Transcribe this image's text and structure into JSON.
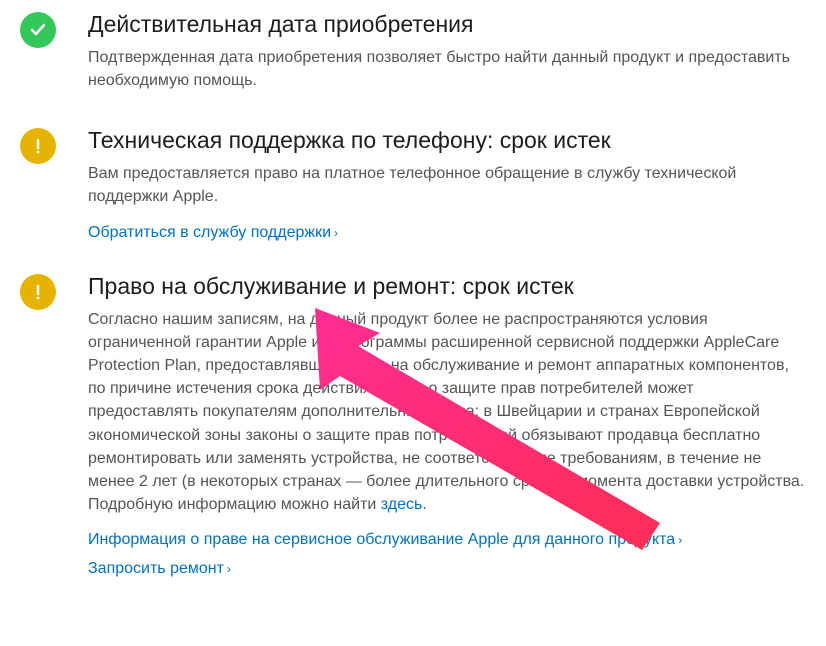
{
  "sections": [
    {
      "icon": "check",
      "title": "Действительная дата приобретения",
      "body": "Подтвержденная дата приобретения позволяет быстро найти данный продукт и предоставить необходимую помощь."
    },
    {
      "icon": "warning",
      "title": "Техническая поддержка по телефону: срок истек",
      "body": "Вам предоставляется право на платное телефонное обращение в службу технической поддержки Apple.",
      "links": [
        {
          "label": "Обратиться в службу поддержки"
        }
      ]
    },
    {
      "icon": "warning",
      "title": "Право на обслуживание и ремонт: срок истек",
      "body_pre": "Согласно нашим записям, на данный продукт более не распространяются условия ограниченной гарантии Apple или программы расширенной сервисной поддержки AppleCare Protection Plan, предоставлявших право на обслуживание и ремонт аппаратных компонентов, по причине истечения срока действия.\nЗакон о защите прав потребителей может предоставлять покупателям дополнительные права: в Швейцарии и странах Европейской экономической зоны законы о защите прав потребителей обязывают продавца бесплатно ремонтировать или заменять устройства, не соответствующие требованиям, в течение не менее 2 лет (в некоторых странах — более длительного срока) с момента доставки устройства. Подробную информацию можно найти ",
      "body_link": "здесь",
      "body_post": ".",
      "links": [
        {
          "label": "Информация о праве на сервисное обслуживание Apple для данного продукта"
        },
        {
          "label": "Запросить ремонт"
        }
      ]
    }
  ]
}
